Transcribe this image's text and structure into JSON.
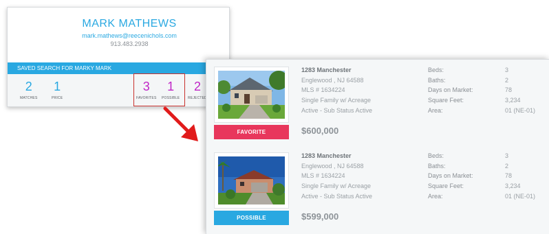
{
  "agent": {
    "name": "MARK MATHEWS",
    "email": "mark.mathews@reecenichols.com",
    "phone": "913.483.2938"
  },
  "saved_search": {
    "title": "SAVED SEARCH FOR MARKY MARK",
    "stats": [
      {
        "value": "2",
        "label": "MATCHES",
        "color": "#29a8e1"
      },
      {
        "value": "1",
        "label": "PRICE",
        "color": "#29a8e1"
      },
      {
        "value": "3",
        "label": "FAVORITES",
        "color": "#c026c6"
      },
      {
        "value": "1",
        "label": "POSSIBLE",
        "color": "#c026c6"
      },
      {
        "value": "2",
        "label": "REJECTED",
        "color": "#c026c6"
      }
    ]
  },
  "listings": [
    {
      "address": "1283 Manchester",
      "city": "Englewood , NJ 64588",
      "mls": "MLS # 1634224",
      "type": "Single Family w/ Acreage",
      "status": "Active - Sub Status Active",
      "price": "$600,000",
      "status_label": "FAVORITE",
      "status_color": "#e8375c",
      "specs": [
        {
          "label": "Beds:",
          "value": "3"
        },
        {
          "label": "Baths:",
          "value": "2"
        },
        {
          "label": "Days on Market:",
          "value": "78"
        },
        {
          "label": "Square Feet:",
          "value": "3,234"
        },
        {
          "label": "Area:",
          "value": "01 (NE-01)"
        }
      ]
    },
    {
      "address": "1283 Manchester",
      "city": "Englewood , NJ 64588",
      "mls": "MLS # 1634224",
      "type": "Single Family w/ Acreage",
      "status": "Active - Sub Status Active",
      "price": "$599,000",
      "status_label": "POSSIBLE",
      "status_color": "#29a8e1",
      "specs": [
        {
          "label": "Beds:",
          "value": "3"
        },
        {
          "label": "Baths:",
          "value": "2"
        },
        {
          "label": "Days on Market:",
          "value": "78"
        },
        {
          "label": "Square Feet:",
          "value": "3,234"
        },
        {
          "label": "Area:",
          "value": "01 (NE-01)"
        }
      ]
    }
  ],
  "annotation": {
    "highlight_color": "#c9302c",
    "arrow_color": "#e11b1b",
    "icon": "red-arrow-icon"
  }
}
